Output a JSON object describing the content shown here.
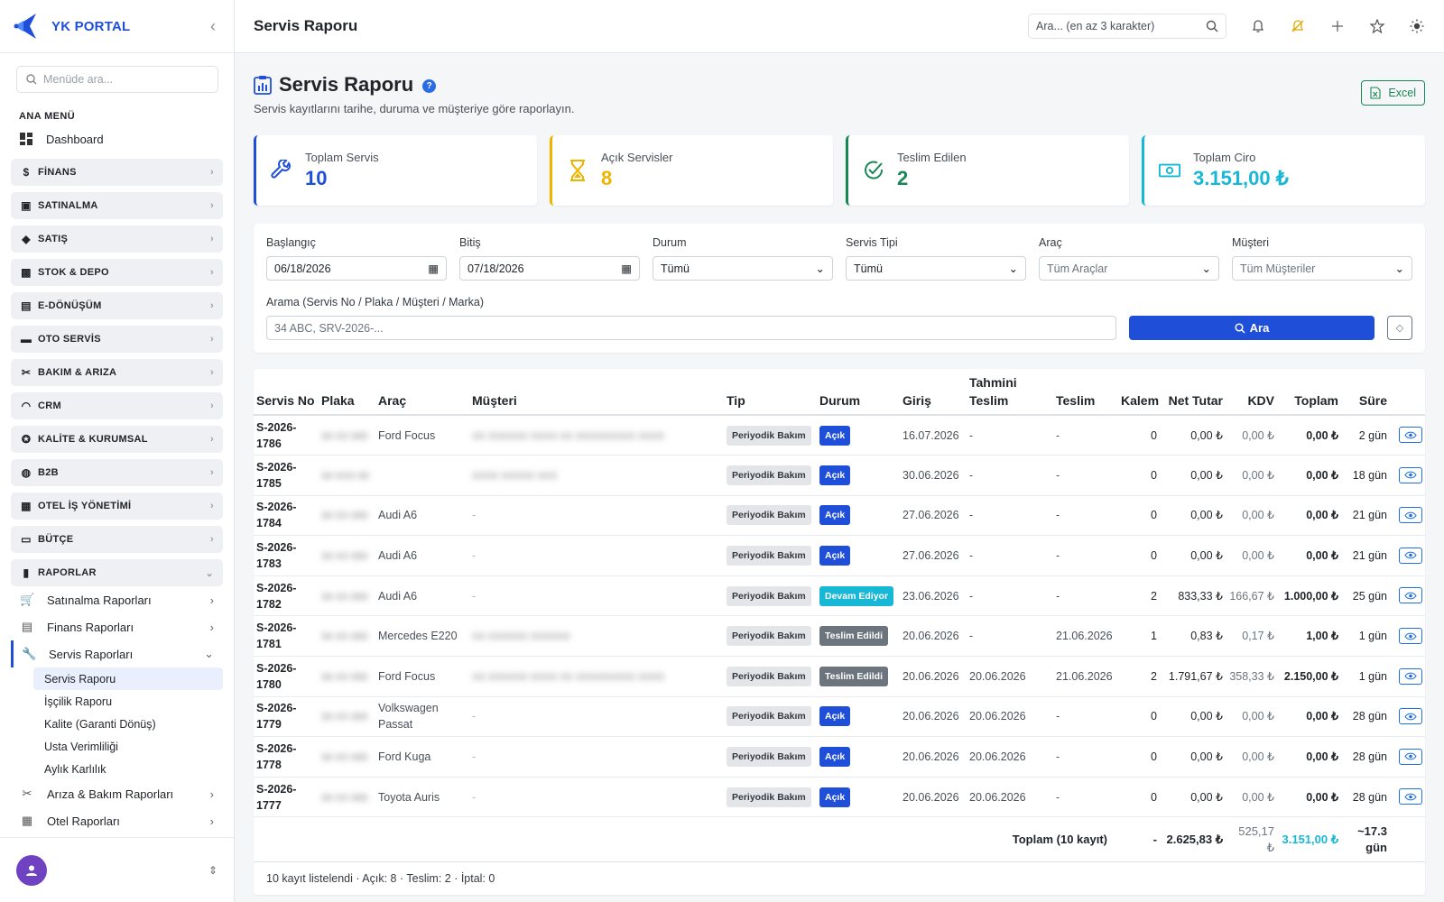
{
  "app": {
    "name": "YK PORTAL",
    "collapse": "‹"
  },
  "sidebar": {
    "search_placeholder": "Menüde ara...",
    "section": "ANA MENÜ",
    "dashboard": "Dashboard",
    "groups": [
      {
        "label": "FİNANS",
        "icon": "finance-icon"
      },
      {
        "label": "SATINALMA",
        "icon": "purchase-icon"
      },
      {
        "label": "SATIŞ",
        "icon": "sales-icon"
      },
      {
        "label": "STOK & DEPO",
        "icon": "stock-icon"
      },
      {
        "label": "E-DÖNÜŞÜM",
        "icon": "edonusum-icon"
      },
      {
        "label": "OTO SERVİS",
        "icon": "car-icon"
      },
      {
        "label": "BAKIM & ARIZA",
        "icon": "tools-icon"
      },
      {
        "label": "CRM",
        "icon": "headset-icon"
      },
      {
        "label": "KALİTE & KURUMSAL",
        "icon": "quality-icon"
      },
      {
        "label": "B2B",
        "icon": "globe-icon"
      },
      {
        "label": "OTEL İŞ YÖNETİMİ",
        "icon": "hotel-icon"
      },
      {
        "label": "BÜTÇE",
        "icon": "wallet-icon"
      },
      {
        "label": "RAPORLAR",
        "icon": "chart-icon"
      }
    ],
    "report_subs": {
      "purchase": "Satınalma Raporları",
      "finance": "Finans Raporları",
      "service": "Servis Raporları",
      "fault": "Arıza & Bakım Raporları",
      "hotel": "Otel Raporları"
    },
    "service_leaves": [
      "Servis Raporu",
      "İşçilik Raporu",
      "Kalite (Garanti Dönüş)",
      "Usta Verimliliği",
      "Aylık Karlılık"
    ]
  },
  "topbar": {
    "title": "Servis Raporu",
    "search_placeholder": "Ara... (en az 3 karakter)"
  },
  "page": {
    "title": "Servis Raporu",
    "help": "?",
    "subtitle": "Servis kayıtlarını tarihe, duruma ve müşteriye göre raporlayın.",
    "excel": "Excel"
  },
  "cards": [
    {
      "label": "Toplam Servis",
      "value": "10",
      "color": "#1f4fd8"
    },
    {
      "label": "Açık Servisler",
      "value": "8",
      "color": "#f0b400"
    },
    {
      "label": "Teslim Edilen",
      "value": "2",
      "color": "#198754"
    },
    {
      "label": "Toplam Ciro",
      "value": "3.151,00 ₺",
      "color": "#17b7d6"
    }
  ],
  "filters": {
    "start_label": "Başlangıç",
    "start": "06/18/2026",
    "end_label": "Bitiş",
    "end": "07/18/2026",
    "status_label": "Durum",
    "status": "Tümü",
    "type_label": "Servis Tipi",
    "type": "Tümü",
    "vehicle_label": "Araç",
    "vehicle": "Tüm Araçlar",
    "customer_label": "Müşteri",
    "customer": "Tüm Müşteriler",
    "search_label": "Arama (Servis No / Plaka / Müşteri / Marka)",
    "search_placeholder": "34 ABC, SRV-2026-...",
    "search_button": "Ara"
  },
  "table": {
    "headers": {
      "no": "Servis No",
      "plate": "Plaka",
      "vehicle": "Araç",
      "customer": "Müşteri",
      "type": "Tip",
      "status": "Durum",
      "in": "Giriş",
      "est": "Tahmini Teslim",
      "out": "Teslim",
      "items": "Kalem",
      "net": "Net Tutar",
      "vat": "KDV",
      "total": "Toplam",
      "dur": "Süre"
    },
    "status_colors": {
      "Açık": "#1f4fd8",
      "Devam Ediyor": "#17b7d6",
      "Teslim Edildi": "#6c757d"
    },
    "rows": [
      {
        "no": "S-2026-1786",
        "plate": "34 XX 000",
        "vehicle": "Ford Focus",
        "customer": "XX XXXXXX XXXX XX XXXXXXXXX XXXX",
        "type": "Periyodik Bakım",
        "status": "Açık",
        "in": "16.07.2026",
        "est": "-",
        "out": "-",
        "items": "0",
        "net": "0,00 ₺",
        "vat": "0,00 ₺",
        "total": "0,00 ₺",
        "dur": "2 gün"
      },
      {
        "no": "S-2026-1785",
        "plate": "34 XXX 00",
        "vehicle": "",
        "customer": "XXXX XXXXX XXX",
        "type": "Periyodik Bakım",
        "status": "Açık",
        "in": "30.06.2026",
        "est": "-",
        "out": "-",
        "items": "0",
        "net": "0,00 ₺",
        "vat": "0,00 ₺",
        "total": "0,00 ₺",
        "dur": "18 gün"
      },
      {
        "no": "S-2026-1784",
        "plate": "34 XX 000",
        "vehicle": "Audi A6",
        "customer": "-",
        "type": "Periyodik Bakım",
        "status": "Açık",
        "in": "27.06.2026",
        "est": "-",
        "out": "-",
        "items": "0",
        "net": "0,00 ₺",
        "vat": "0,00 ₺",
        "total": "0,00 ₺",
        "dur": "21 gün"
      },
      {
        "no": "S-2026-1783",
        "plate": "34 XX 000",
        "vehicle": "Audi A6",
        "customer": "-",
        "type": "Periyodik Bakım",
        "status": "Açık",
        "in": "27.06.2026",
        "est": "-",
        "out": "-",
        "items": "0",
        "net": "0,00 ₺",
        "vat": "0,00 ₺",
        "total": "0,00 ₺",
        "dur": "21 gün"
      },
      {
        "no": "S-2026-1782",
        "plate": "34 XX 000",
        "vehicle": "Audi A6",
        "customer": "-",
        "type": "Periyodik Bakım",
        "status": "Devam Ediyor",
        "in": "23.06.2026",
        "est": "-",
        "out": "-",
        "items": "2",
        "net": "833,33 ₺",
        "vat": "166,67 ₺",
        "total": "1.000,00 ₺",
        "dur": "25 gün"
      },
      {
        "no": "S-2026-1781",
        "plate": "34 XX 000",
        "vehicle": "Mercedes E220",
        "customer": "XX XXXXXX XXXXXX",
        "type": "Periyodik Bakım",
        "status": "Teslim Edildi",
        "in": "20.06.2026",
        "est": "-",
        "out": "21.06.2026",
        "items": "1",
        "net": "0,83 ₺",
        "vat": "0,17 ₺",
        "total": "1,00 ₺",
        "dur": "1 gün"
      },
      {
        "no": "S-2026-1780",
        "plate": "34 XX 000",
        "vehicle": "Ford Focus",
        "customer": "XX XXXXXX XXXX XX XXXXXXXXX XXXX",
        "type": "Periyodik Bakım",
        "status": "Teslim Edildi",
        "in": "20.06.2026",
        "est": "20.06.2026",
        "out": "21.06.2026",
        "items": "2",
        "net": "1.791,67 ₺",
        "vat": "358,33 ₺",
        "total": "2.150,00 ₺",
        "dur": "1 gün"
      },
      {
        "no": "S-2026-1779",
        "plate": "34 XX 000",
        "vehicle": "Volkswagen Passat",
        "customer": "-",
        "type": "Periyodik Bakım",
        "status": "Açık",
        "in": "20.06.2026",
        "est": "20.06.2026",
        "out": "-",
        "items": "0",
        "net": "0,00 ₺",
        "vat": "0,00 ₺",
        "total": "0,00 ₺",
        "dur": "28 gün"
      },
      {
        "no": "S-2026-1778",
        "plate": "34 XX 000",
        "vehicle": "Ford Kuga",
        "customer": "-",
        "type": "Periyodik Bakım",
        "status": "Açık",
        "in": "20.06.2026",
        "est": "20.06.2026",
        "out": "-",
        "items": "0",
        "net": "0,00 ₺",
        "vat": "0,00 ₺",
        "total": "0,00 ₺",
        "dur": "28 gün"
      },
      {
        "no": "S-2026-1777",
        "plate": "34 XX 000",
        "vehicle": "Toyota Auris",
        "customer": "-",
        "type": "Periyodik Bakım",
        "status": "Açık",
        "in": "20.06.2026",
        "est": "20.06.2026",
        "out": "-",
        "items": "0",
        "net": "0,00 ₺",
        "vat": "0,00 ₺",
        "total": "0,00 ₺",
        "dur": "28 gün"
      }
    ],
    "footer": {
      "label": "Toplam (10 kayıt)",
      "items": "-",
      "net": "2.625,83 ₺",
      "vat": "525,17 ₺",
      "total": "3.151,00 ₺",
      "dur": "~17.3 gün"
    },
    "summary": "10 kayıt listelendi · Açık: 8 · Teslim: 2 · İptal: 0"
  }
}
